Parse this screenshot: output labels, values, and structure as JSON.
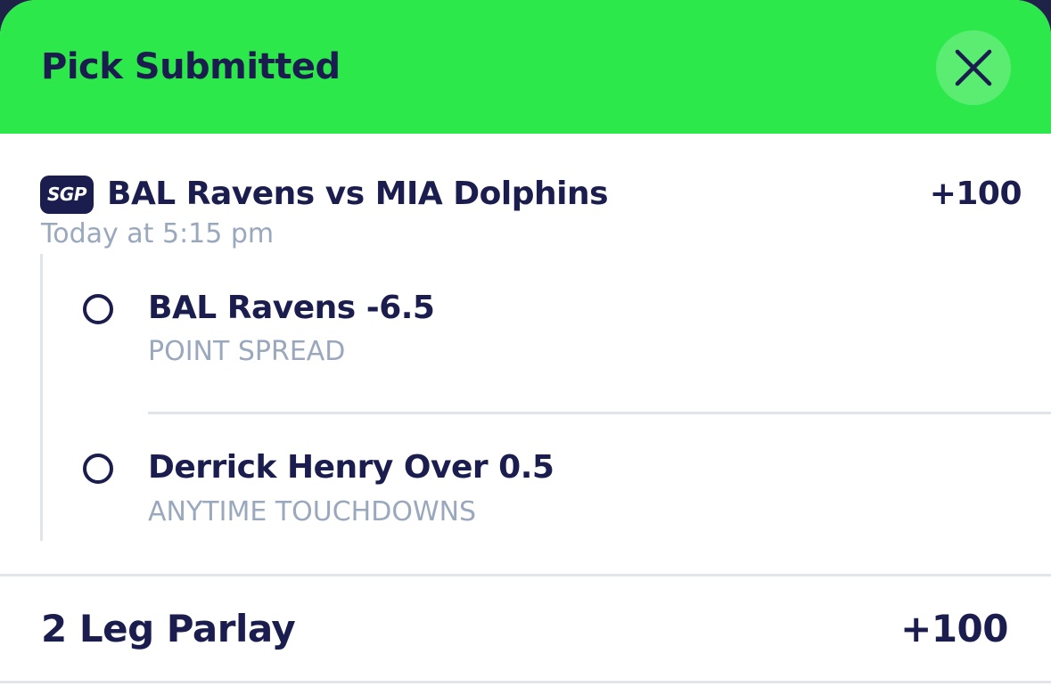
{
  "header": {
    "title": "Pick Submitted",
    "close_icon": "close-icon",
    "background_color": "#2ce84a"
  },
  "game": {
    "badge": "SGP",
    "title": "BAL Ravens vs MIA Dolphins",
    "odds": "+100",
    "time": "Today at 5:15 pm"
  },
  "legs": [
    {
      "selection": "BAL Ravens -6.5",
      "market": "POINT SPREAD"
    },
    {
      "selection": "Derrick Henry Over 0.5",
      "market": "ANYTIME TOUCHDOWNS"
    }
  ],
  "parlay": {
    "label": "2 Leg Parlay",
    "odds": "+100"
  },
  "colors": {
    "primary_text": "#1a1d4e",
    "secondary_text": "#9aa8bd",
    "accent_green": "#2ce84a"
  }
}
